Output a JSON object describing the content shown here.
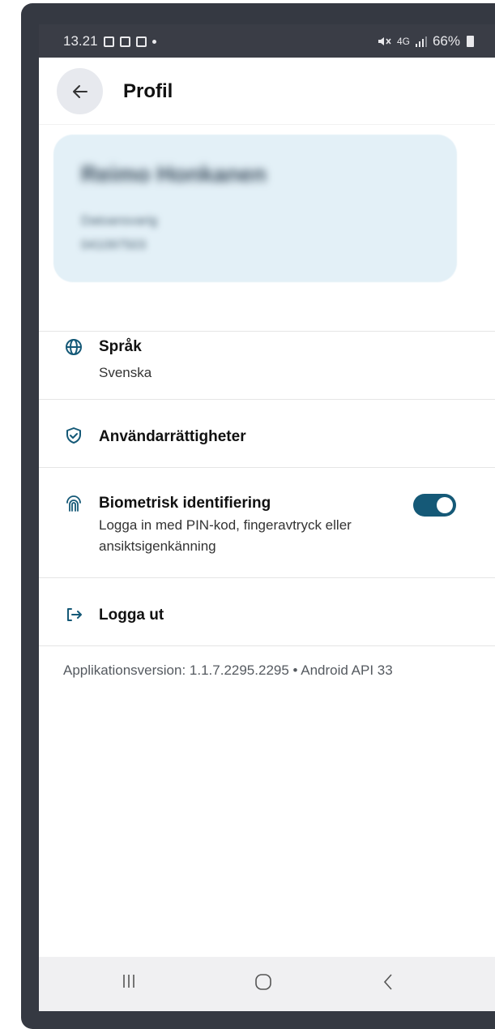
{
  "status_bar": {
    "time": "13.21",
    "network": "4G",
    "battery": "66%"
  },
  "header": {
    "title": "Profil"
  },
  "user": {
    "name": "Reimo Honkanen",
    "role": "Datoansvarig",
    "id": "041097503"
  },
  "settings": {
    "language": {
      "label": "Språk",
      "value": "Svenska",
      "icon": "globe-icon"
    },
    "permissions": {
      "label": "Användarrättigheter",
      "icon": "shield-check-icon"
    },
    "biometric": {
      "label": "Biometrisk identifiering",
      "description": "Logga in med PIN-kod, fingeravtryck eller ansiktsigenkänning",
      "enabled": true,
      "icon": "fingerprint-icon"
    },
    "logout": {
      "label": "Logga ut",
      "icon": "logout-icon"
    }
  },
  "footer": {
    "version": "Applikationsversion: 1.1.7.2295.2295 • Android API 33"
  },
  "colors": {
    "accent": "#155977",
    "card_bg": "#e3f0f7",
    "status_bar_bg": "#3a3d46"
  }
}
